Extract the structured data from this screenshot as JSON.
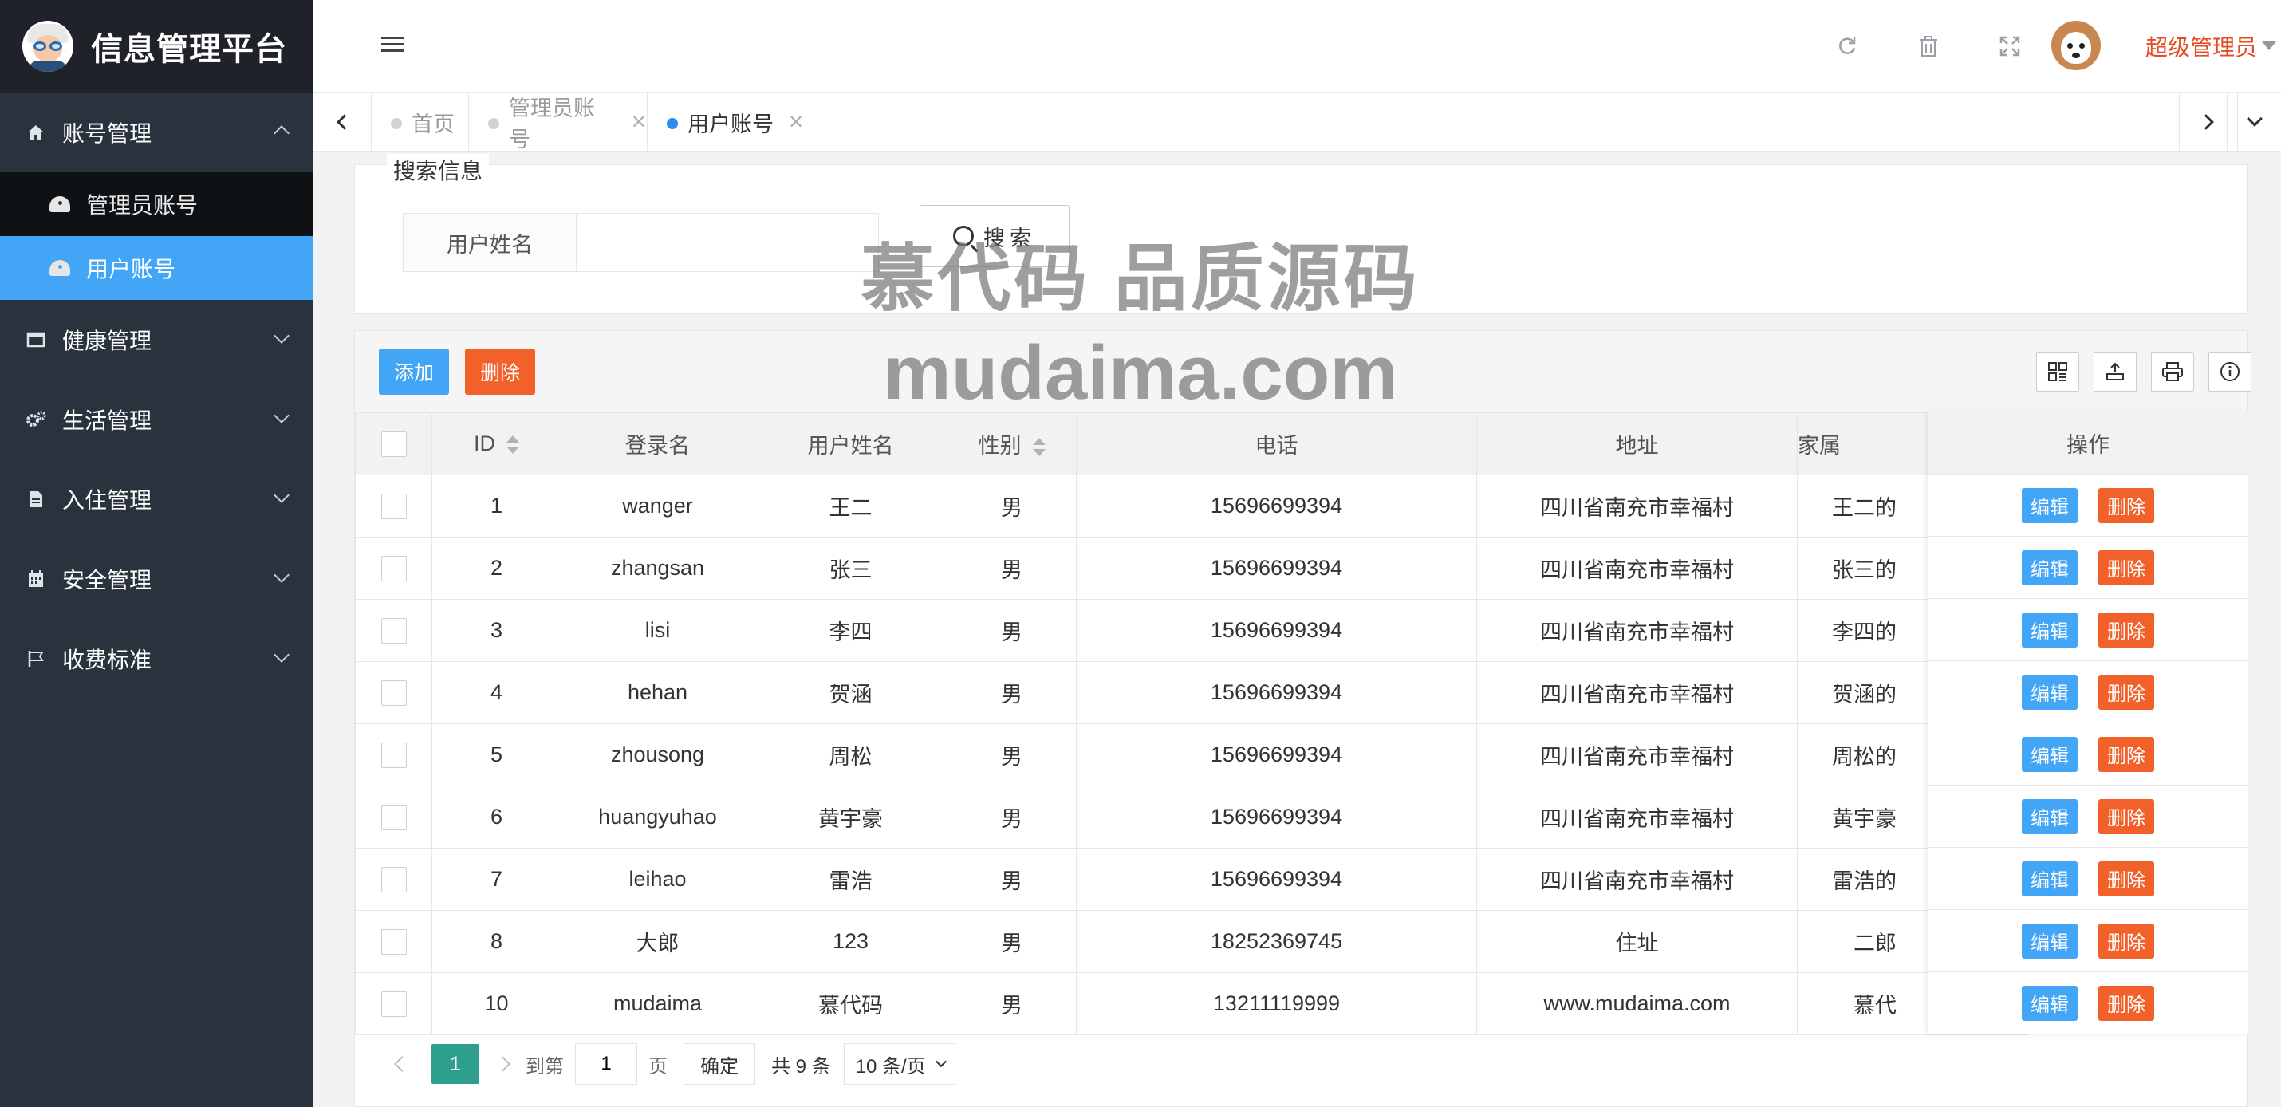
{
  "app": {
    "title": "信息管理平台"
  },
  "sidebar": {
    "groups": [
      {
        "label": "账号管理",
        "icon": "home-icon",
        "expanded": true,
        "items": [
          {
            "label": "管理员账号",
            "active": false
          },
          {
            "label": "用户账号",
            "active": true
          }
        ]
      },
      {
        "label": "健康管理",
        "icon": "window-icon"
      },
      {
        "label": "生活管理",
        "icon": "gears-icon"
      },
      {
        "label": "入住管理",
        "icon": "document-icon"
      },
      {
        "label": "安全管理",
        "icon": "calendar-icon"
      },
      {
        "label": "收费标准",
        "icon": "flag-icon"
      }
    ]
  },
  "header": {
    "user_name": "超级管理员"
  },
  "tabs": [
    {
      "label": "首页",
      "active": false,
      "closable": false
    },
    {
      "label": "管理员账号",
      "active": false,
      "closable": true
    },
    {
      "label": "用户账号",
      "active": true,
      "closable": true
    }
  ],
  "search": {
    "legend": "搜索信息",
    "label": "用户姓名",
    "value": "",
    "button": "搜索"
  },
  "toolbar": {
    "add": "添加",
    "delete": "删除"
  },
  "table": {
    "columns": [
      "ID",
      "登录名",
      "用户姓名",
      "性别",
      "电话",
      "地址",
      "家属",
      "操作"
    ],
    "rows": [
      [
        "1",
        "wanger",
        "王二",
        "男",
        "15696699394",
        "四川省南充市幸福村",
        "王二的"
      ],
      [
        "2",
        "zhangsan",
        "张三",
        "男",
        "15696699394",
        "四川省南充市幸福村",
        "张三的"
      ],
      [
        "3",
        "lisi",
        "李四",
        "男",
        "15696699394",
        "四川省南充市幸福村",
        "李四的"
      ],
      [
        "4",
        "hehan",
        "贺涵",
        "男",
        "15696699394",
        "四川省南充市幸福村",
        "贺涵的"
      ],
      [
        "5",
        "zhousong",
        "周松",
        "男",
        "15696699394",
        "四川省南充市幸福村",
        "周松的"
      ],
      [
        "6",
        "huangyuhao",
        "黄宇豪",
        "男",
        "15696699394",
        "四川省南充市幸福村",
        "黄宇豪"
      ],
      [
        "7",
        "leihao",
        "雷浩",
        "男",
        "15696699394",
        "四川省南充市幸福村",
        "雷浩的"
      ],
      [
        "8",
        "大郎",
        "123",
        "男",
        "18252369745",
        "住址",
        "二郎"
      ],
      [
        "10",
        "mudaima",
        "慕代码",
        "男",
        "13211119999",
        "www.mudaima.com",
        "慕代"
      ]
    ],
    "edit_label": "编辑",
    "delete_label": "删除"
  },
  "pager": {
    "current": "1",
    "goto_prefix": "到第",
    "goto_value": "1",
    "goto_suffix": "页",
    "confirm": "确定",
    "total": "共 9 条",
    "page_size": "10 条/页"
  },
  "watermark": {
    "line1": "慕代码 品质源码",
    "line2": "mudaima.com"
  }
}
